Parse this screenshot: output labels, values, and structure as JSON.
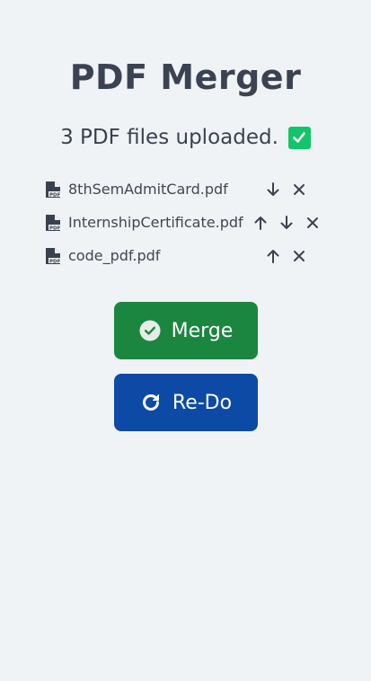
{
  "title": "PDF Merger",
  "status_text": "3 PDF files uploaded.",
  "files": [
    {
      "name": "8thSemAdmitCard.pdf"
    },
    {
      "name": "InternshipCertificate.pdf"
    },
    {
      "name": "code_pdf.pdf"
    }
  ],
  "buttons": {
    "merge": "Merge",
    "redo": "Re-Do"
  },
  "icons": {
    "file": "pdf-file-icon",
    "status": "check-square-icon",
    "merge": "check-circle-icon",
    "redo": "redo-arrow-icon",
    "up": "arrow-up-icon",
    "down": "arrow-down-icon",
    "remove": "close-icon"
  },
  "colors": {
    "background": "#f0f3f5",
    "merge_button": "#1b8640",
    "redo_button": "#0d4aa6",
    "status_check": "#12c46a"
  }
}
